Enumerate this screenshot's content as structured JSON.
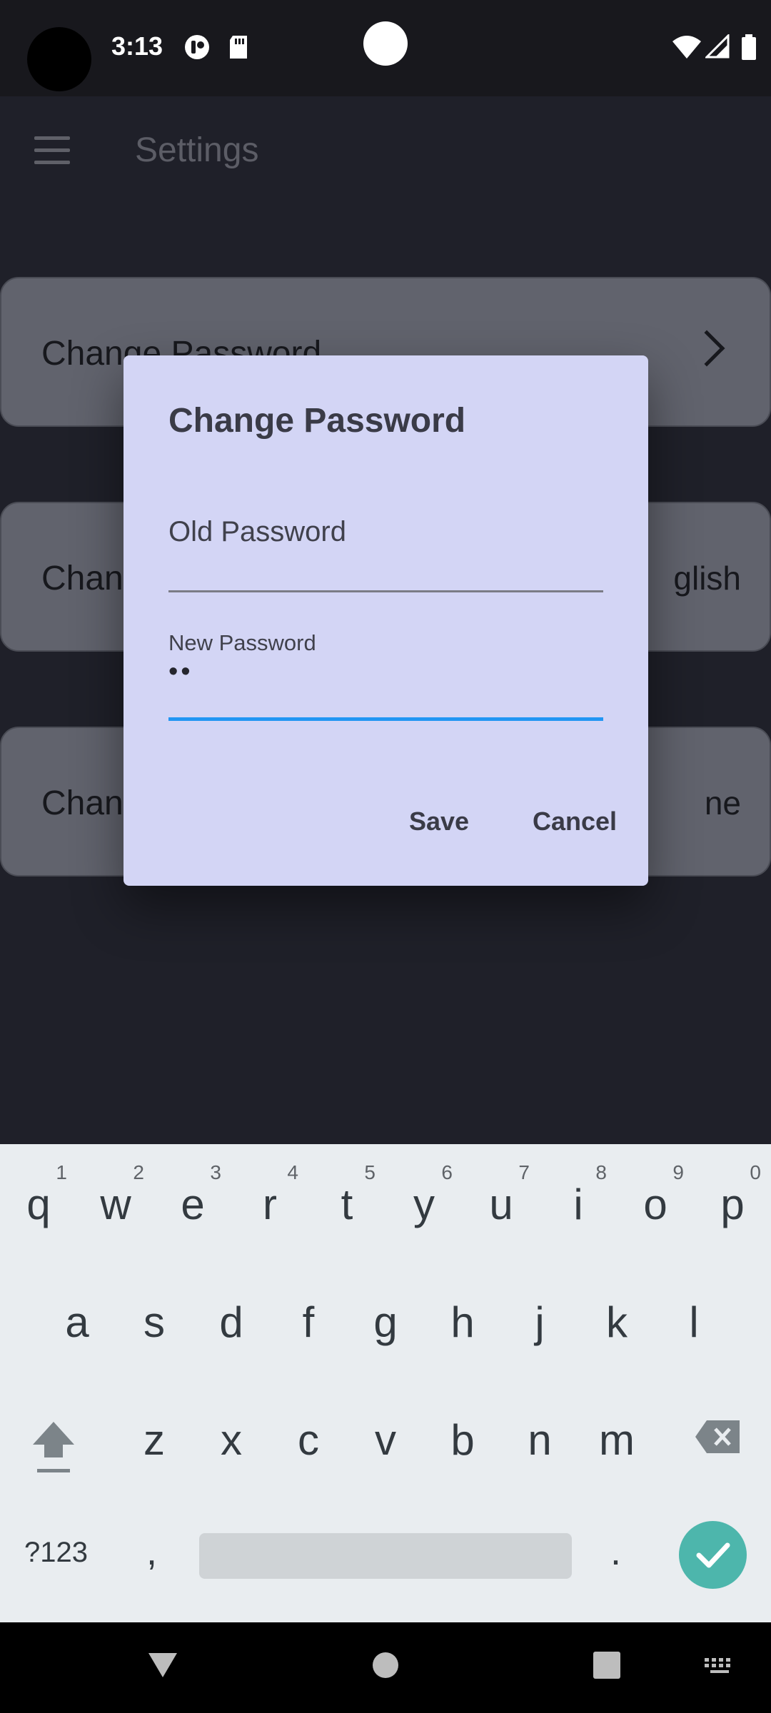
{
  "status_bar": {
    "time": "3:13"
  },
  "app_bar": {
    "title": "Settings"
  },
  "settings_rows": [
    {
      "label": "Change Password",
      "value": ""
    },
    {
      "label": "Chan",
      "value": "glish"
    },
    {
      "label": "Chan",
      "value": "ne"
    }
  ],
  "dialog": {
    "title": "Change Password",
    "old_password_label": "Old Password",
    "old_password_value": "",
    "new_password_label": "New Password",
    "new_password_value": "••",
    "save_label": "Save",
    "cancel_label": "Cancel",
    "accent_color": "#2196f3"
  },
  "keyboard": {
    "row1": [
      {
        "ch": "q",
        "hint": "1"
      },
      {
        "ch": "w",
        "hint": "2"
      },
      {
        "ch": "e",
        "hint": "3"
      },
      {
        "ch": "r",
        "hint": "4"
      },
      {
        "ch": "t",
        "hint": "5"
      },
      {
        "ch": "y",
        "hint": "6"
      },
      {
        "ch": "u",
        "hint": "7"
      },
      {
        "ch": "i",
        "hint": "8"
      },
      {
        "ch": "o",
        "hint": "9"
      },
      {
        "ch": "p",
        "hint": "0"
      }
    ],
    "row2": [
      "a",
      "s",
      "d",
      "f",
      "g",
      "h",
      "j",
      "k",
      "l"
    ],
    "row3": [
      "z",
      "x",
      "c",
      "v",
      "b",
      "n",
      "m"
    ],
    "symbols_label": "?123",
    "comma": ",",
    "period": ".",
    "enter_color": "#4db6ac"
  }
}
